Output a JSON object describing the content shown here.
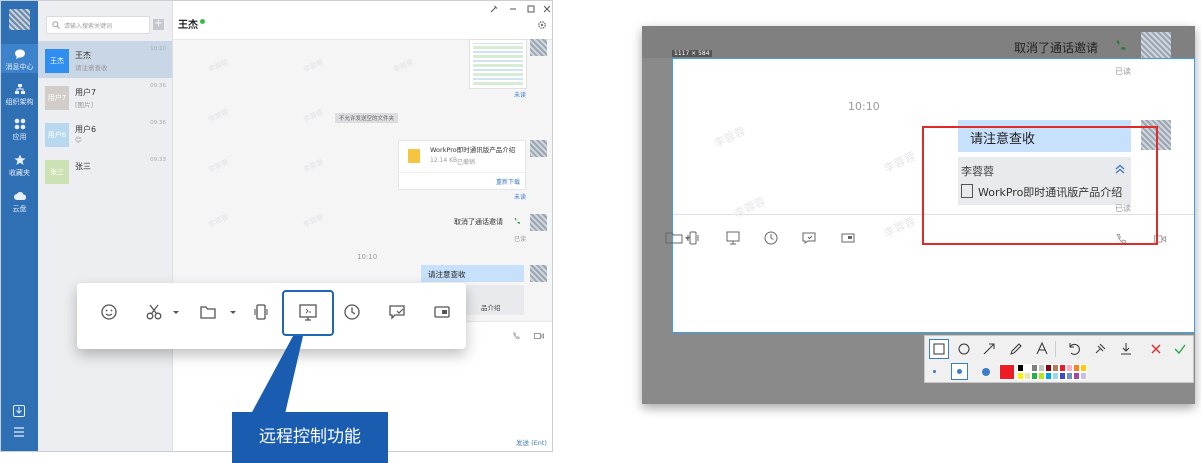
{
  "sidebar": {
    "items": [
      {
        "label": "消息中心",
        "icon": "chat-bubble-icon"
      },
      {
        "label": "组织架构",
        "icon": "org-chart-icon"
      },
      {
        "label": "应用",
        "icon": "apps-grid-icon"
      },
      {
        "label": "收藏夹",
        "icon": "star-icon"
      },
      {
        "label": "云盘",
        "icon": "cloud-icon"
      }
    ]
  },
  "search": {
    "placeholder": "请输入搜索关键词"
  },
  "conversations": [
    {
      "name": "王杰",
      "avatar_text": "王杰",
      "preview": "请注意查收",
      "time": "10:10",
      "color": "#2f8ef0"
    },
    {
      "name": "用户7",
      "avatar_text": "用户7",
      "preview": "[图片]",
      "time": "09:36",
      "color": "#d2cdc8"
    },
    {
      "name": "用户6",
      "avatar_text": "用户6",
      "preview": "😊",
      "time": "09:36",
      "color": "#b8d8f0"
    },
    {
      "name": "张三",
      "avatar_text": "张三",
      "preview": "",
      "time": "09:33",
      "color": "#cde2b4"
    }
  ],
  "chat": {
    "title": "王杰",
    "unread_label": "未读",
    "read_label": "已读",
    "notice": "不允许发送空的文件夹",
    "file": {
      "name": "WorkPro即时通讯版产品介绍",
      "size": "12.14 KB",
      "status": "已撤销",
      "action": "重新下载"
    },
    "call_text": "取消了通话邀请",
    "time_divider": "10:10",
    "message": "请注意查收",
    "quote_file": "品介绍",
    "send_label": "发送 (Ent)"
  },
  "callout": "远程控制功能",
  "right": {
    "size_label": "1117 × 584",
    "call_text": "取消了通话邀请",
    "read_label": "已读",
    "time_divider": "10:10",
    "message": "请注意查收",
    "quote_name": "李蓉蓉",
    "quote_file": "WorkPro即时通讯版产品介绍",
    "read_label2": "已读",
    "watermark": "李蓉蓉"
  },
  "colors": {
    "accent": "#2f6fb4",
    "callout": "#1a5db0",
    "highlight": "#e02b2b",
    "palette": [
      "#000000",
      "#ffffff",
      "#7f7f7f",
      "#c3c3c3",
      "#880015",
      "#b97a57",
      "#ed1c24",
      "#ffaec9",
      "#ff7f27",
      "#ffc90e",
      "#fff200",
      "#efe4b0",
      "#22b14c",
      "#b5e61d",
      "#00a2e8",
      "#99d9ea",
      "#3f48cc",
      "#7092be",
      "#a349a4",
      "#c8bfe7"
    ]
  }
}
